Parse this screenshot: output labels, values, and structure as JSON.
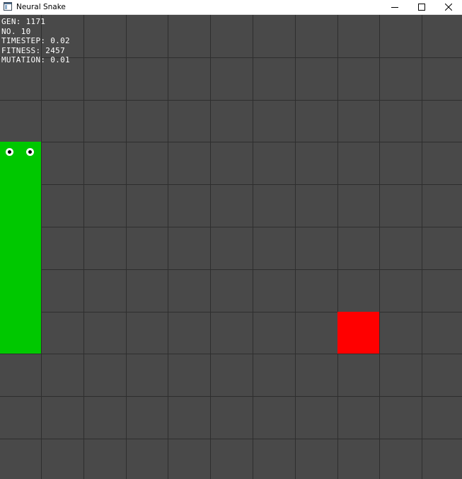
{
  "window": {
    "title": "Neural Snake",
    "icon": "app-window-icon",
    "controls": [
      "minimize-icon",
      "maximize-icon",
      "close-icon"
    ]
  },
  "hud": {
    "lines": [
      "GEN: 1171",
      "NO. 10",
      "TIMESTEP: 0.02",
      "FITNESS: 2457",
      "MUTATION: 0.01"
    ]
  },
  "board": {
    "columns": 11,
    "rows": 11,
    "background_color": "#494949",
    "grid_color": "#2e2e2e",
    "snake_color": "#00c800",
    "food_color": "#ff0000",
    "snake": {
      "head": [
        0,
        3
      ],
      "segments": [
        [
          0,
          3
        ],
        [
          0,
          4
        ],
        [
          0,
          5
        ],
        [
          0,
          6
        ],
        [
          0,
          7
        ]
      ],
      "direction": "up"
    },
    "food": [
      8,
      7
    ]
  }
}
